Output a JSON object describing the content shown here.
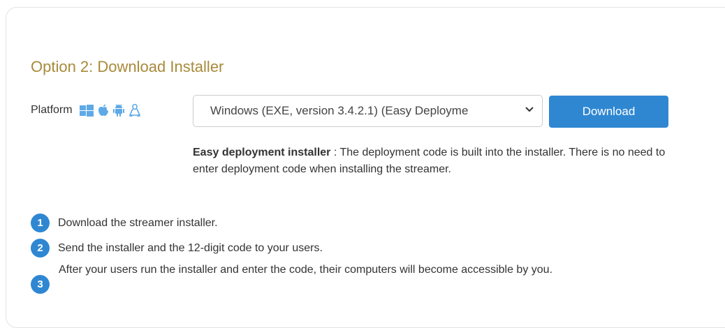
{
  "section_title": "Option 2: Download Installer",
  "platform": {
    "label": "Platform",
    "icons": [
      "windows-icon",
      "apple-icon",
      "android-icon",
      "linux-icon"
    ],
    "icon_color": "#5ea9e6"
  },
  "installer_select": {
    "value": "Windows (EXE, version 3.4.2.1) (Easy Deployme"
  },
  "download_button": {
    "label": "Download",
    "color": "#2f87d2"
  },
  "description": {
    "bold": "Easy deployment installer",
    "text": " : The deployment code is built into the installer. There is no need to enter deployment code when installing the streamer."
  },
  "steps": [
    {
      "number": "1",
      "text": "Download the streamer installer."
    },
    {
      "number": "2",
      "text": "Send the installer and the 12-digit code to your users."
    },
    {
      "number": "3",
      "text": "After your users run the installer and enter the code, their computers will become accessible by you."
    }
  ],
  "colors": {
    "accent_title": "#a88a3a",
    "primary": "#2f87d2"
  }
}
